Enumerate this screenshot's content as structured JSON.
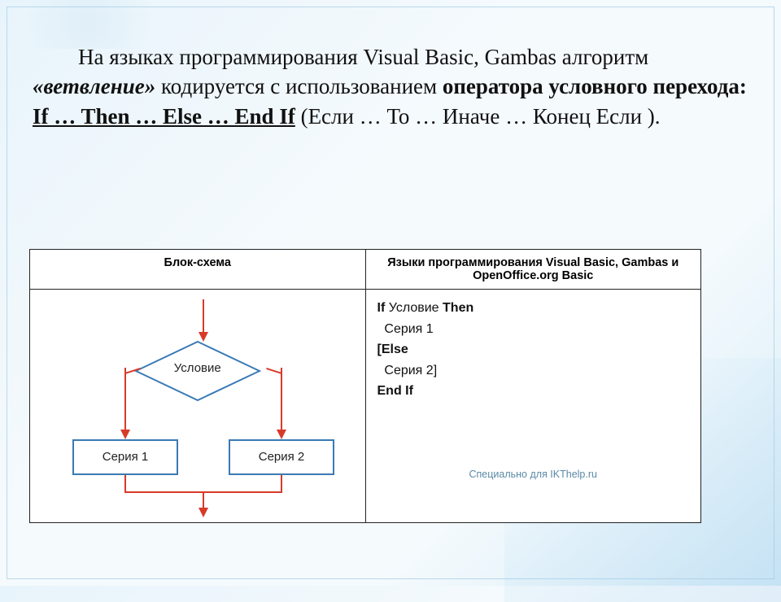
{
  "para": {
    "t1": "На языках программирования Visual Basic, Gambas алгоритм ",
    "t2": "«ветвление»",
    "t3": " кодируется с использованием ",
    "t4": "оператора условного перехода:",
    "t5": "    ",
    "t6": "If … Then … Else … End If",
    "t7": " (Если … То … Иначе … Конец Если ).",
    "sp": " "
  },
  "table": {
    "header1": "Блок-схема",
    "header2": "Языки программирования Visual Basic, Gambas и OpenOffice.org Basic"
  },
  "diagram": {
    "condition": "Условие",
    "branch1": "Серия 1",
    "branch2": "Серия 2"
  },
  "code": {
    "l1a": "If",
    "l1b": "  Условие  ",
    "l1c": "Then",
    "l2": "  Серия 1",
    "l3a": "[Else",
    "l4": "  Серия 2]",
    "l5a": "End",
    "l5b": "  If"
  },
  "credit": "Специально для IKThelp.ru"
}
